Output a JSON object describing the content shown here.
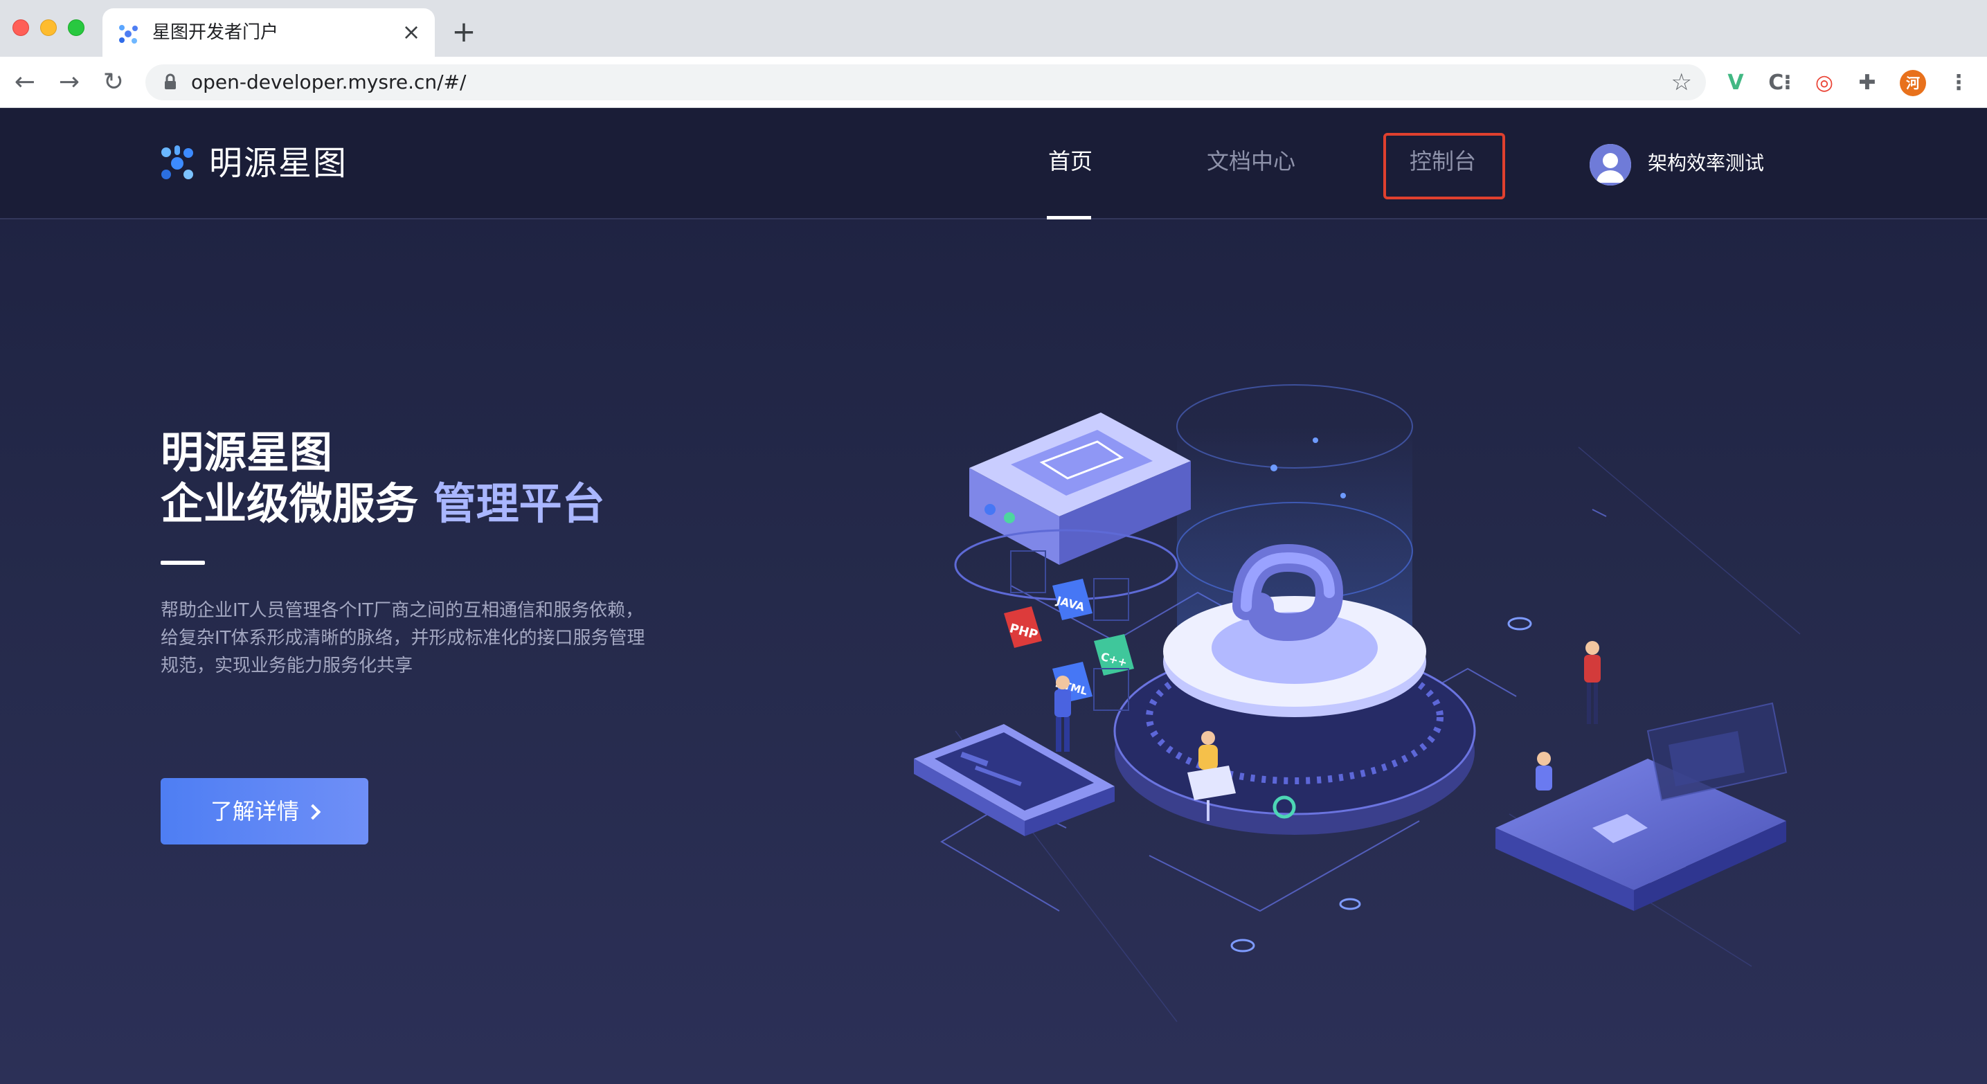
{
  "browser": {
    "tab_title": "星图开发者门户",
    "tab_close": "×",
    "new_tab": "+",
    "back": "←",
    "forward": "→",
    "reload": "↻",
    "url": "open-developer.mysre.cn/#/",
    "bookmark": "☆",
    "extensions": [
      {
        "name": "vue-devtools-icon",
        "glyph": "V",
        "color": "#41b883"
      },
      {
        "name": "cookie-icon",
        "glyph": "C⁝",
        "color": "#5f6368"
      },
      {
        "name": "chrome-ring-icon",
        "glyph": "◎",
        "color": "#ea4335"
      },
      {
        "name": "puzzle-icon",
        "glyph": "✚",
        "color": "#5f6368"
      },
      {
        "name": "profile-icon",
        "glyph": "河",
        "color": "#e8711c"
      },
      {
        "name": "menu-icon",
        "glyph": "⋮",
        "color": "#5f6368"
      }
    ]
  },
  "header": {
    "brand": "明源星图",
    "nav": {
      "home": "首页",
      "docs": "文档中心",
      "console": "控制台"
    },
    "user": "架构效率测试"
  },
  "hero": {
    "title_line1": "明源星图",
    "title_line2_main": "企业级微服务 ",
    "title_line2_accent": "管理平台",
    "description": "帮助企业IT人员管理各个IT厂商之间的互相通信和服务依赖，给复杂IT体系形成清晰的脉络，并形成标准化的接口服务管理规范，实现业务能力服务化共享",
    "cta": "了解详情"
  },
  "illustration": {
    "badges": [
      "PHP",
      "JAVA",
      "HTML",
      "C++"
    ]
  },
  "colors": {
    "page_bg": "#232745",
    "header_bg": "#1a1d37",
    "accent_text": "#a9b6ff",
    "cta": "#4e7ef3",
    "highlight_box": "#e0402e"
  }
}
